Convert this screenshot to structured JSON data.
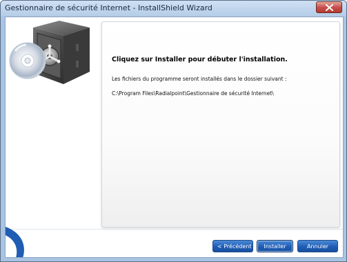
{
  "window": {
    "title": "Gestionnaire de sécurité Internet - InstallShield Wizard"
  },
  "content": {
    "heading": "Cliquez sur Installer pour débuter l'installation.",
    "description": "Les fichiers du programme seront installés dans le dossier suivant :",
    "install_path": "C:\\Program Files\\Radialpoint\\Gestionnaire de sécurité Internet\\"
  },
  "buttons": {
    "previous": "< Précédent",
    "install": "Installer",
    "cancel": "Annuler"
  },
  "icons": {
    "close": "close-icon",
    "graphic": "cd-safe-icon"
  },
  "colors": {
    "button_blue": "#1f5db5",
    "titlebar": "#b9d1ea",
    "close_red": "#c75050"
  }
}
